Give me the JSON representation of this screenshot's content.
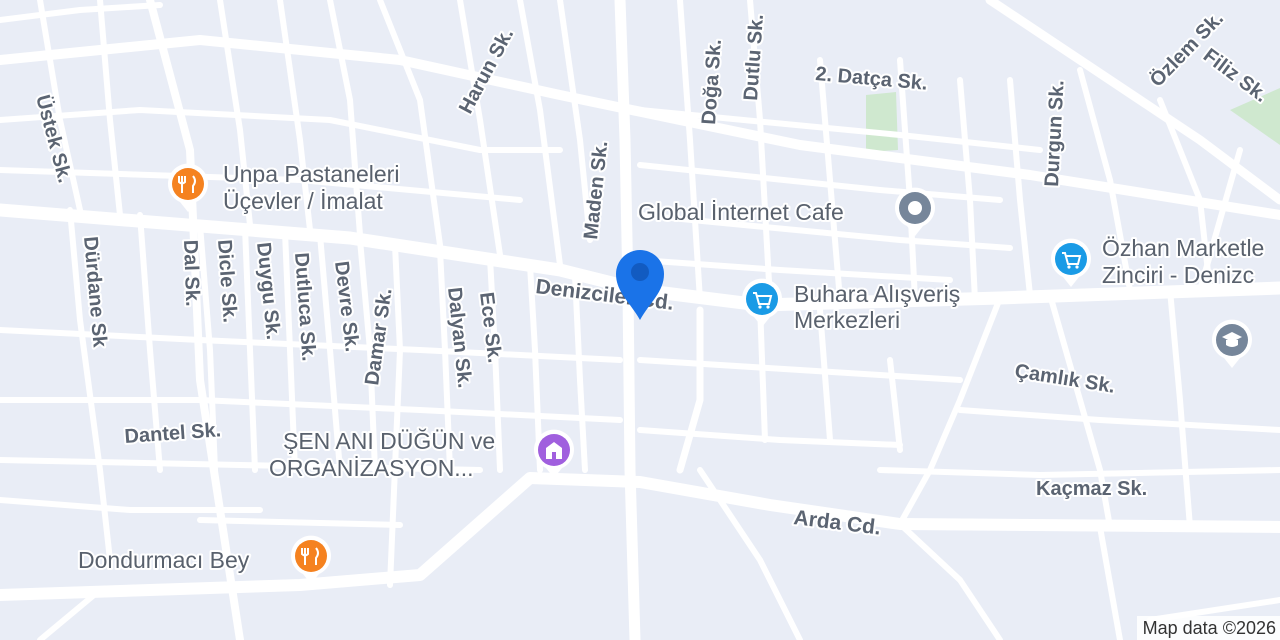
{
  "colors": {
    "land": "#e9edf6",
    "road": "#ffffff",
    "park": "#cfe8cf",
    "marker_blue": "#1a73e8",
    "poi_food": "#f58220",
    "poi_shopping": "#1a9be6",
    "poi_generic": "#76869a",
    "poi_event": "#a05fde"
  },
  "streets": {
    "denizciler": "Denizciler Cd.",
    "arda": "Arda Cd.",
    "ustek": "Üstek Sk.",
    "durdane": "Dürdane Sk",
    "dal": "Dal Sk.",
    "dicle": "Dicle Sk.",
    "duygu": "Duygu Sk.",
    "dutluca": "Dutluca Sk.",
    "devre": "Devre Sk.",
    "damar": "Damar Sk.",
    "dalyan": "Dalyan Sk.",
    "ece": "Ece Sk.",
    "harun": "Harun Sk.",
    "maden": "Maden Sk.",
    "doga": "Doğa Sk.",
    "dutlu": "Dutlu Sk.",
    "datca": "2. Datça Sk.",
    "durgun": "Durgun Sk.",
    "ozlem": "Özlem Sk.",
    "filiz": "Filiz Sk.",
    "camlik": "Çamlık Sk.",
    "kacmaz": "Kaçmaz Sk.",
    "dantel": "Dantel Sk."
  },
  "pois": {
    "unpa": {
      "line1": "Unpa Pastaneleri",
      "line2": "Üçevler / İmalat",
      "icon": "restaurant-icon"
    },
    "global": {
      "line1": "Global İnternet Cafe",
      "icon": "generic-place-icon"
    },
    "buhara": {
      "line1": "Buhara Alışveriş",
      "line2": "Merkezleri",
      "icon": "shopping-cart-icon"
    },
    "ozhan": {
      "line1": "Özhan Marketle",
      "line2": "Zinciri - Denizc",
      "icon": "shopping-cart-icon"
    },
    "school": {
      "icon": "graduation-cap-icon"
    },
    "sen": {
      "line1": "ŞEN ANI DÜĞÜN ve",
      "line2": "ORGANİZASYON...",
      "icon": "event-venue-icon"
    },
    "dondurmaci": {
      "line1": "Dondurmacı Bey",
      "icon": "restaurant-icon"
    }
  },
  "attribution": "Map data ©2026"
}
